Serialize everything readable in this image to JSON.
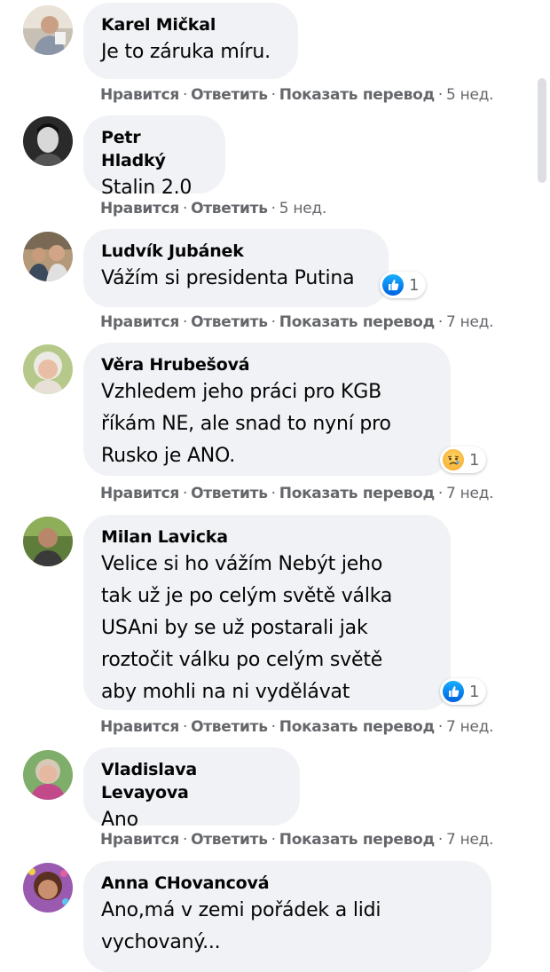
{
  "comments": [
    {
      "author": "Karel Mičkal",
      "text": [
        "Je to záruka míru."
      ],
      "actions": {
        "like": "Нравится",
        "reply": "Ответить",
        "translate": "Показать перевод",
        "time": "5 нед."
      }
    },
    {
      "author": "Petr Hladký",
      "text": [
        "Stalin 2.0"
      ],
      "actions": {
        "like": "Нравится",
        "reply": "Ответить",
        "time": "5 нед."
      }
    },
    {
      "author": "Ludvík Jubánek",
      "text": [
        "Vážím si presidenta Putina"
      ],
      "reaction": {
        "type": "like",
        "count": "1"
      },
      "actions": {
        "like": "Нравится",
        "reply": "Ответить",
        "translate": "Показать перевод",
        "time": "7 нед."
      }
    },
    {
      "author": "Věra Hrubešová",
      "text": [
        "Vzhledem jeho práci pro KGB",
        "říkám NE, ale snad to nyní pro",
        "Rusko je ANO."
      ],
      "reaction": {
        "type": "sad",
        "count": "1"
      },
      "actions": {
        "like": "Нравится",
        "reply": "Ответить",
        "translate": "Показать перевод",
        "time": "7 нед."
      }
    },
    {
      "author": "Milan Lavicka",
      "text": [
        "Velice si ho vážím Nebýt jeho",
        "tak už je po celým světě válka",
        "USAni by se už postarali jak",
        "roztočit válku po celým světě",
        "aby mohli na ni vydělávat"
      ],
      "reaction": {
        "type": "like",
        "count": "1"
      },
      "actions": {
        "like": "Нравится",
        "reply": "Ответить",
        "translate": "Показать перевод",
        "time": "7 нед."
      }
    },
    {
      "author": "Vladislava Levayova",
      "text": [
        "Ano"
      ],
      "actions": {
        "like": "Нравится",
        "reply": "Ответить",
        "translate": "Показать перевод",
        "time": "7 нед."
      }
    },
    {
      "author": "Anna CHovancová",
      "text": [
        "Ano,má v zemi pořádek a lidi",
        "vychovaný..."
      ]
    }
  ],
  "colors": {
    "bubble": "#f0f2f5",
    "meta_text": "#65676b",
    "like_blue": "#1877f2"
  }
}
